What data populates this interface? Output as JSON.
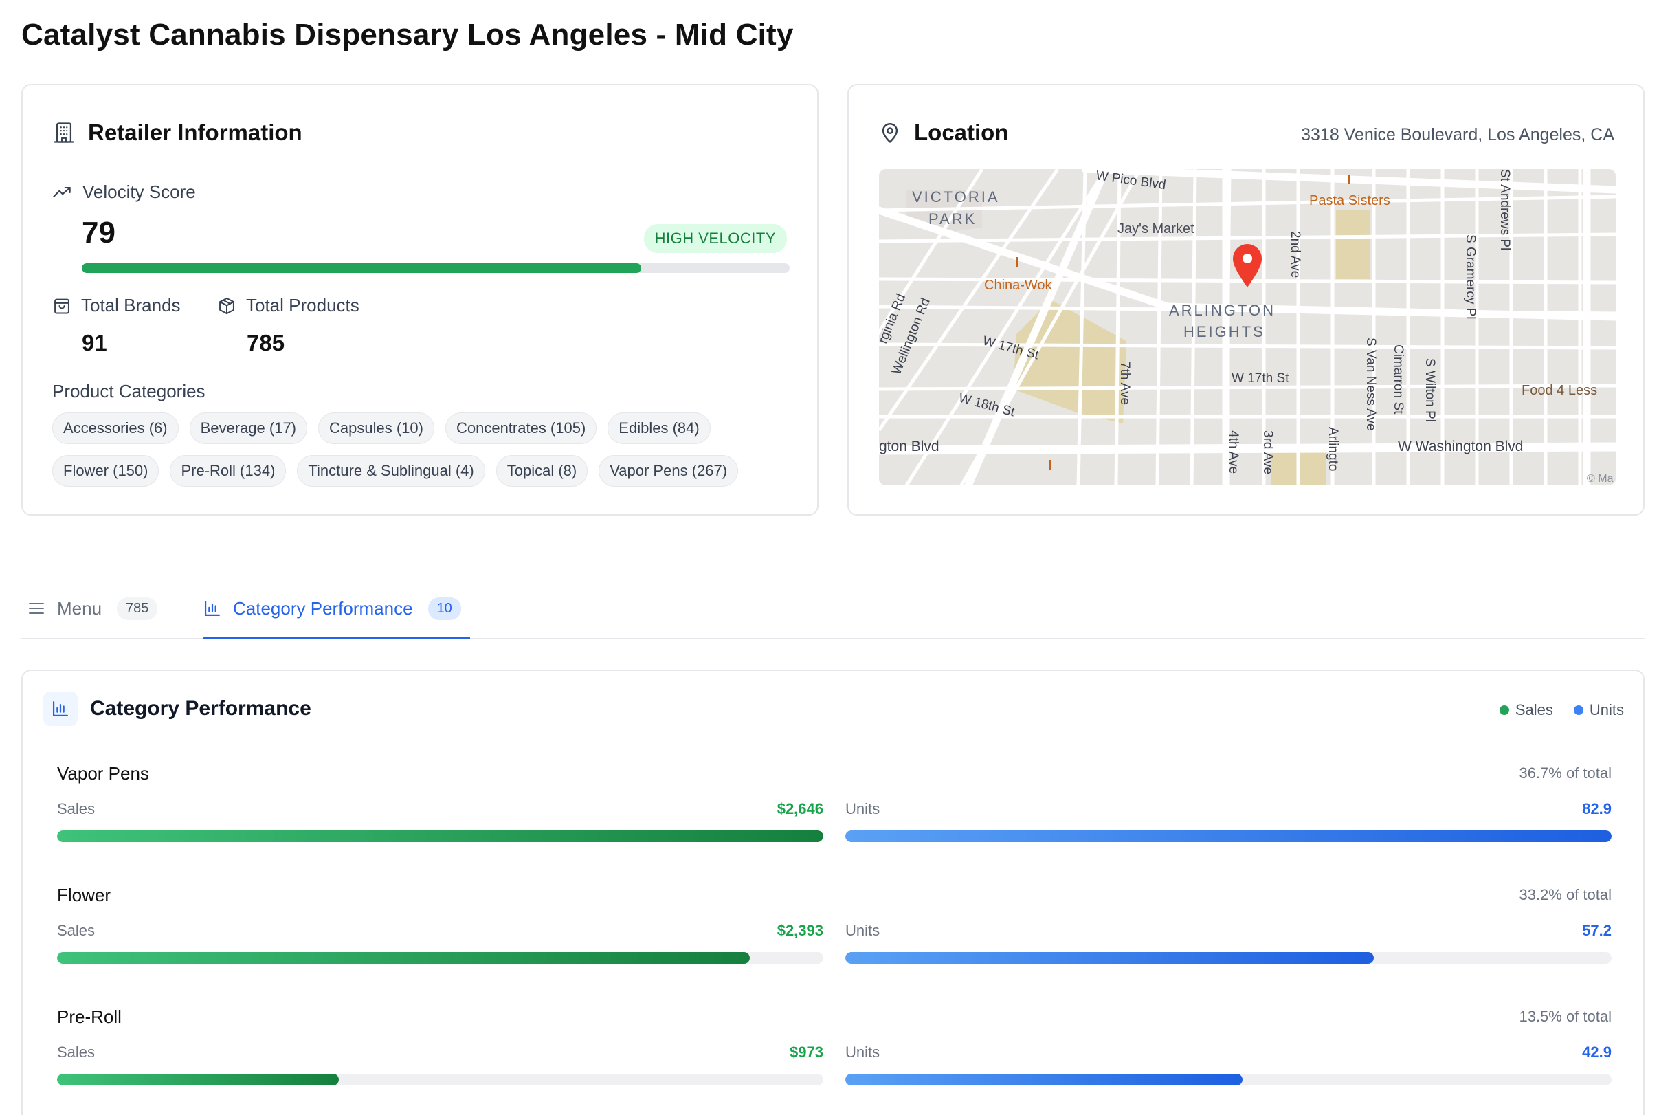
{
  "page": {
    "title": "Catalyst Cannabis Dispensary Los Angeles - Mid City"
  },
  "retailer": {
    "title": "Retailer Information",
    "velocity_label": "Velocity Score",
    "velocity_score": "79",
    "velocity_fraction": 0.79,
    "velocity_badge": "HIGH VELOCITY",
    "brands_label": "Total Brands",
    "brands_value": "91",
    "products_label": "Total Products",
    "products_value": "785",
    "categories_label": "Product Categories",
    "categories": [
      "Accessories (6)",
      "Beverage (17)",
      "Capsules (10)",
      "Concentrates (105)",
      "Edibles (84)",
      "Flower (150)",
      "Pre-Roll (134)",
      "Tincture & Sublingual (4)",
      "Topical (8)",
      "Vapor Pens (267)"
    ]
  },
  "location": {
    "title": "Location",
    "address": "3318 Venice Boulevard, Los Angeles, CA",
    "map_labels": {
      "victoria": "VICTORIA",
      "park": "PARK",
      "arlington": "ARLINGTON",
      "heights": "HEIGHTS",
      "pico": "W Pico Blvd",
      "jays": "Jay's Market",
      "pasta": "Pasta Sisters",
      "china": "China-Wok",
      "food4less": "Food 4 Less",
      "w17a": "W 17th St",
      "w17b": "W 17th St",
      "w18": "W 18th St",
      "washington": "W Washington Blvd",
      "ington": "gton Blvd",
      "ave2": "2nd Ave",
      "ave3": "3rd Ave",
      "ave4": "4th Ave",
      "ave7": "7th Ave",
      "gramercy": "S Gramercy Pl",
      "standrews": "St Andrews Pl",
      "vanness": "S Van Ness Ave",
      "cimarron": "Cimarron St",
      "wilton": "S Wilton Pl",
      "arlingtonave": "Arlingto",
      "wellington": "Wellington Rd",
      "virginia": "rginia Rd",
      "attrib": "© Ma"
    }
  },
  "tabs": [
    {
      "label": "Menu",
      "count": "785"
    },
    {
      "label": "Category Performance",
      "count": "10"
    }
  ],
  "performance": {
    "title": "Category Performance",
    "legend_sales": "Sales",
    "legend_units": "Units",
    "sales_label": "Sales",
    "units_label": "Units",
    "rows": [
      {
        "name": "Vapor Pens",
        "share": "36.7% of total",
        "sales": "$2,646",
        "sales_fraction": 1.0,
        "units": "82.9",
        "units_fraction": 1.0
      },
      {
        "name": "Flower",
        "share": "33.2% of total",
        "sales": "$2,393",
        "sales_fraction": 0.904,
        "units": "57.2",
        "units_fraction": 0.69
      },
      {
        "name": "Pre-Roll",
        "share": "13.5% of total",
        "sales": "$973",
        "sales_fraction": 0.368,
        "units": "42.9",
        "units_fraction": 0.518
      }
    ]
  },
  "colors": {
    "accent": "#2563eb",
    "success": "#16a34a",
    "pin": "#ef3b2c"
  }
}
